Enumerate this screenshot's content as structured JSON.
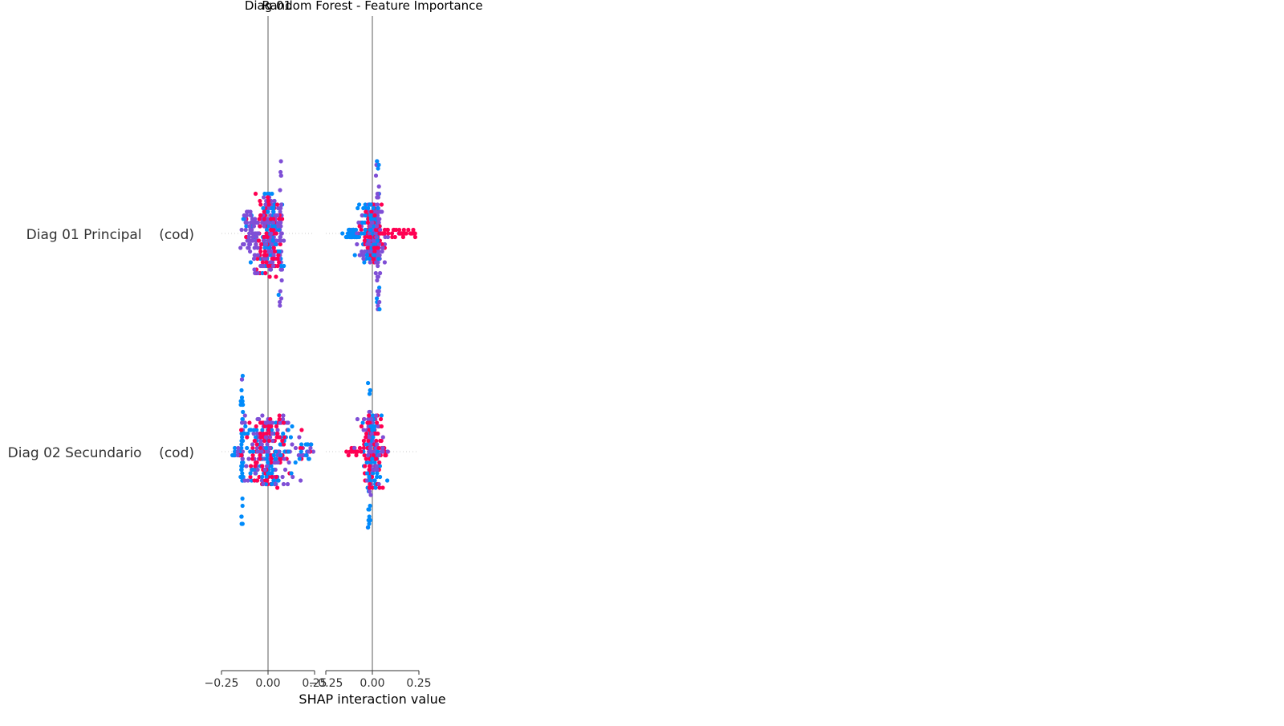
{
  "chart_data": {
    "type": "scatter",
    "title": "Random Forest - Feature Importance",
    "xlabel": "SHAP interaction value",
    "xlim": [
      -0.25,
      0.25
    ],
    "x_ticks": [
      {
        "value": -0.25,
        "label": "−0.25"
      },
      {
        "value": 0.0,
        "label": "0.00"
      },
      {
        "value": 0.25,
        "label": "0.25"
      }
    ],
    "features": [
      "Diag 01 Principal    (cod)",
      "Diag 02 Secundario    (cod)"
    ],
    "column_titles": [
      "Diag 01",
      ""
    ],
    "colors": {
      "low": "#008bfb",
      "mid": "#7f4fd6",
      "high": "#ff0052",
      "zero_line": "#999999",
      "row_guide": "#cccccc",
      "axis": "#333333"
    },
    "panels": [
      {
        "column": 0,
        "rows": [
          {
            "feature": "Diag 01 Principal    (cod)",
            "clusters": [
              {
                "x": 0.068,
                "spread": 0.006,
                "n": 40,
                "height": 1.0,
                "mix": [
                  0.1,
                  0.85,
                  0.05
                ]
              },
              {
                "x": 0.02,
                "spread": 0.028,
                "n": 150,
                "height": 0.45,
                "mix": [
                  0.45,
                  0.35,
                  0.2
                ]
              },
              {
                "x": -0.02,
                "spread": 0.03,
                "n": 110,
                "height": 0.55,
                "mix": [
                  0.15,
                  0.35,
                  0.5
                ]
              },
              {
                "x": -0.095,
                "spread": 0.025,
                "n": 55,
                "height": 0.28,
                "mix": [
                  0.05,
                  0.9,
                  0.05
                ]
              }
            ]
          },
          {
            "feature": "Diag 02 Secundario    (cod)",
            "clusters": [
              {
                "x": -0.14,
                "spread": 0.004,
                "n": 45,
                "height": 1.0,
                "mix": [
                  0.95,
                  0.05,
                  0.0
                ]
              },
              {
                "x": 0.0,
                "spread": 0.06,
                "n": 300,
                "height": 0.46,
                "mix": [
                  0.3,
                  0.35,
                  0.35
                ]
              },
              {
                "x": -0.17,
                "spread": 0.02,
                "n": 14,
                "height": 0.06,
                "mix": [
                  0.3,
                  0.3,
                  0.4
                ]
              },
              {
                "x": 0.2,
                "spread": 0.04,
                "n": 30,
                "height": 0.1,
                "mix": [
                  0.55,
                  0.3,
                  0.15
                ]
              }
            ]
          }
        ]
      },
      {
        "column": 1,
        "rows": [
          {
            "feature": "Diag 01 Principal    (cod)",
            "clusters": [
              {
                "x": 0.03,
                "spread": 0.005,
                "n": 45,
                "height": 1.0,
                "mix": [
                  0.2,
                  0.8,
                  0.0
                ]
              },
              {
                "x": 0.0,
                "spread": 0.03,
                "n": 260,
                "height": 0.38,
                "mix": [
                  0.35,
                  0.4,
                  0.25
                ]
              },
              {
                "x": -0.1,
                "spread": 0.025,
                "n": 40,
                "height": 0.06,
                "mix": [
                  0.9,
                  0.1,
                  0.0
                ]
              },
              {
                "x": 0.15,
                "spread": 0.06,
                "n": 40,
                "height": 0.04,
                "mix": [
                  0.0,
                  0.1,
                  0.9
                ]
              }
            ]
          },
          {
            "feature": "Diag 02 Secundario    (cod)",
            "clusters": [
              {
                "x": -0.015,
                "spread": 0.004,
                "n": 45,
                "height": 1.0,
                "mix": [
                  0.8,
                  0.2,
                  0.0
                ]
              },
              {
                "x": 0.0,
                "spread": 0.025,
                "n": 180,
                "height": 0.48,
                "mix": [
                  0.35,
                  0.3,
                  0.35
                ]
              },
              {
                "x": -0.1,
                "spread": 0.02,
                "n": 20,
                "height": 0.03,
                "mix": [
                  0.0,
                  0.1,
                  0.9
                ]
              },
              {
                "x": 0.06,
                "spread": 0.02,
                "n": 20,
                "height": 0.06,
                "mix": [
                  0.1,
                  0.3,
                  0.6
                ]
              }
            ]
          }
        ]
      }
    ]
  }
}
